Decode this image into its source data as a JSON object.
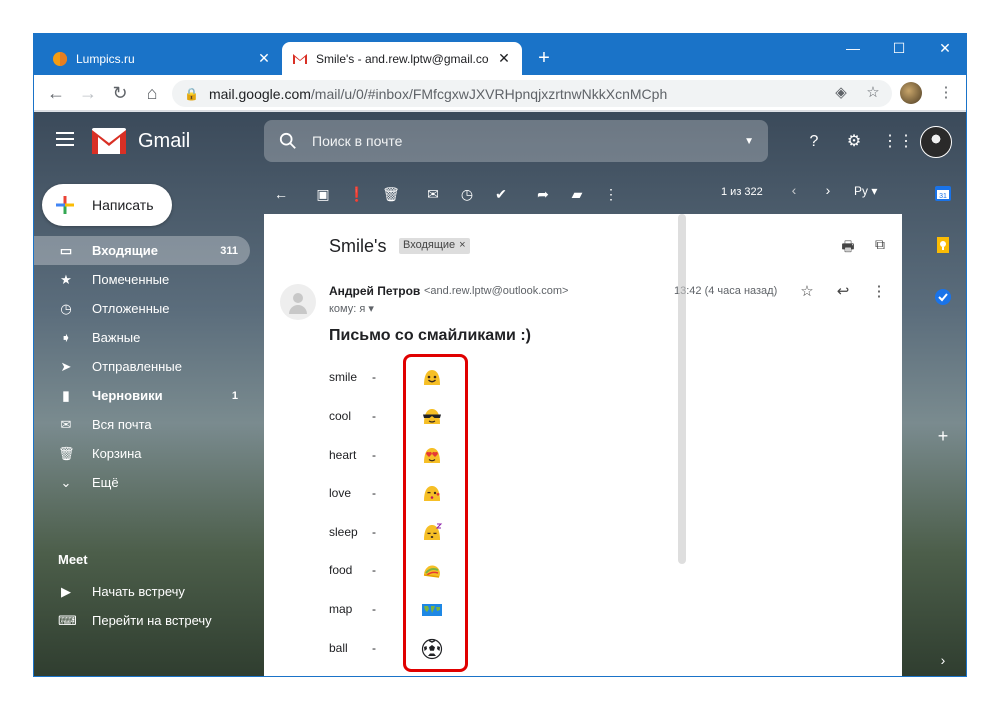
{
  "browser": {
    "tabs": [
      {
        "title": "Lumpics.ru",
        "active": false
      },
      {
        "title": "Smile's - and.rew.lptw@gmail.co",
        "active": true
      }
    ],
    "new_tab": "+",
    "controls": {
      "minimize": "—",
      "maximize": "☐",
      "close": "✕"
    },
    "url_host": "mail.google.com",
    "url_rest": "/mail/u/0/#inbox/FMfcgxwJXVRHpnqjxzrtnwNkkXcnMCph"
  },
  "gmail": {
    "logo_text": "Gmail",
    "search_placeholder": "Поиск в почте",
    "compose_label": "Написать",
    "sidebar": [
      {
        "label": "Входящие",
        "count": "311",
        "icon": "inbox-icon",
        "active": true
      },
      {
        "label": "Помеченные",
        "count": "",
        "icon": "star-icon"
      },
      {
        "label": "Отложенные",
        "count": "",
        "icon": "clock-icon"
      },
      {
        "label": "Важные",
        "count": "",
        "icon": "important-icon"
      },
      {
        "label": "Отправленные",
        "count": "",
        "icon": "send-icon"
      },
      {
        "label": "Черновики",
        "count": "1",
        "icon": "draft-icon",
        "bold": true
      },
      {
        "label": "Вся почта",
        "count": "",
        "icon": "mail-icon"
      },
      {
        "label": "Корзина",
        "count": "",
        "icon": "trash-icon"
      },
      {
        "label": "Ещё",
        "count": "",
        "icon": "chevron-down-icon"
      }
    ],
    "meet": {
      "title": "Meet",
      "items": [
        {
          "label": "Начать встречу",
          "icon": "video-icon"
        },
        {
          "label": "Перейти на встречу",
          "icon": "keyboard-icon"
        }
      ]
    },
    "pager": "1 из 322",
    "lang": "Ру ▾"
  },
  "message": {
    "subject": "Smile's",
    "label": "Входящие",
    "sender_name": "Андрей Петров",
    "sender_email": "<and.rew.lptw@outlook.com>",
    "to": "кому: я",
    "time": "13:42 (4 часа назад)",
    "body_title": "Письмо со смайликами :)",
    "emojis": [
      {
        "word": "smile",
        "dash": "-",
        "emoji": "smile"
      },
      {
        "word": "cool",
        "dash": "-",
        "emoji": "cool"
      },
      {
        "word": "heart",
        "dash": "-",
        "emoji": "heart"
      },
      {
        "word": "love",
        "dash": "-",
        "emoji": "love"
      },
      {
        "word": "sleep",
        "dash": "-",
        "emoji": "sleep"
      },
      {
        "word": "food",
        "dash": "-",
        "emoji": "food"
      },
      {
        "word": "map",
        "dash": "-",
        "emoji": "map"
      },
      {
        "word": "ball",
        "dash": "-",
        "emoji": "ball"
      }
    ]
  },
  "colors": {
    "chrome_blue": "#1a73c8",
    "highlight": "#e00000",
    "emoji_yellow": "#f6bf26"
  }
}
